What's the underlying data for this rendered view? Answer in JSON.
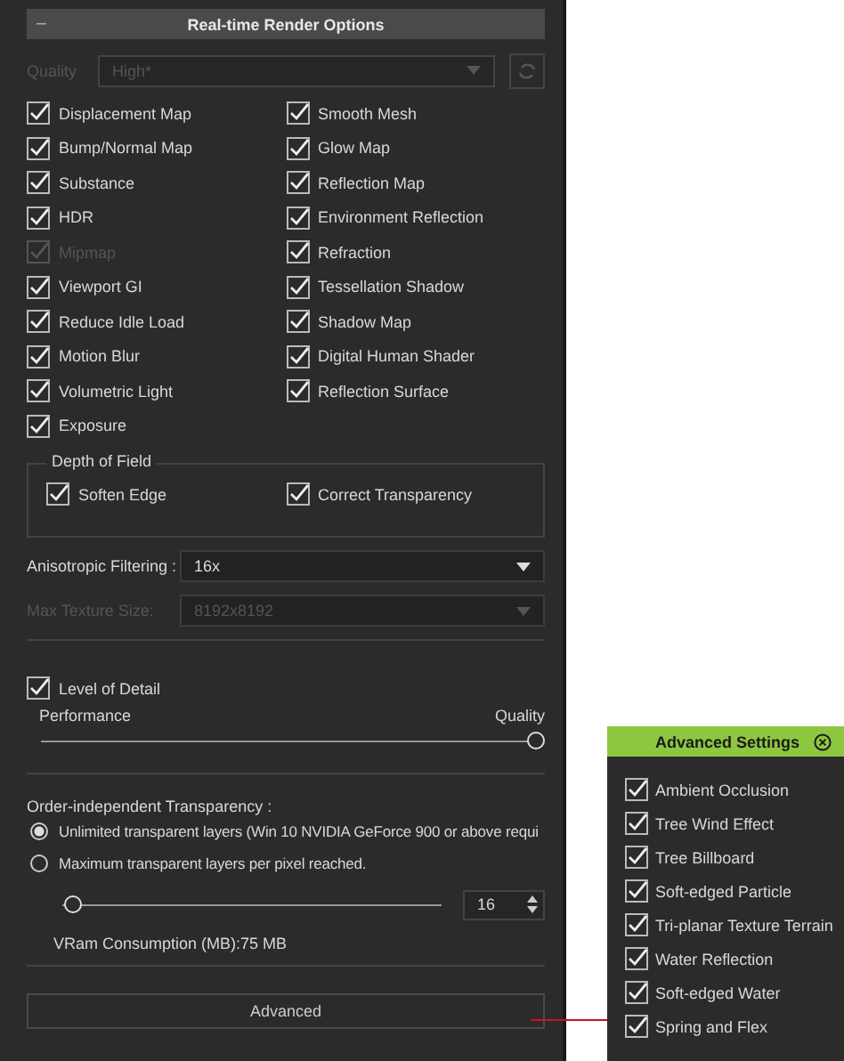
{
  "section_header": {
    "collapse_icon": "−",
    "title": "Real-time Render Options"
  },
  "quality": {
    "label": "Quality",
    "value": "High*",
    "disabled": true
  },
  "options_left": [
    {
      "label": "Displacement Map",
      "checked": true,
      "disabled": false
    },
    {
      "label": "Bump/Normal Map",
      "checked": true,
      "disabled": false
    },
    {
      "label": "Substance",
      "checked": true,
      "disabled": false
    },
    {
      "label": "HDR",
      "checked": true,
      "disabled": false
    },
    {
      "label": "Mipmap",
      "checked": true,
      "disabled": true
    },
    {
      "label": "Viewport GI",
      "checked": true,
      "disabled": false
    },
    {
      "label": "Reduce Idle Load",
      "checked": true,
      "disabled": false
    },
    {
      "label": "Motion Blur",
      "checked": true,
      "disabled": false
    },
    {
      "label": "Volumetric Light",
      "checked": true,
      "disabled": false
    },
    {
      "label": "Exposure",
      "checked": true,
      "disabled": false
    }
  ],
  "options_right": [
    {
      "label": "Smooth Mesh",
      "checked": true,
      "disabled": false
    },
    {
      "label": "Glow Map",
      "checked": true,
      "disabled": false
    },
    {
      "label": "Reflection Map",
      "checked": true,
      "disabled": false
    },
    {
      "label": "Environment Reflection",
      "checked": true,
      "disabled": false
    },
    {
      "label": "Refraction",
      "checked": true,
      "disabled": false
    },
    {
      "label": "Tessellation Shadow",
      "checked": true,
      "disabled": false
    },
    {
      "label": "Shadow Map",
      "checked": true,
      "disabled": false
    },
    {
      "label": "Digital Human Shader",
      "checked": true,
      "disabled": false
    },
    {
      "label": "Reflection Surface",
      "checked": true,
      "disabled": false
    }
  ],
  "depth_of_field": {
    "title": "Depth of Field",
    "options": [
      {
        "label": "Soften Edge",
        "checked": true
      },
      {
        "label": "Correct Transparency",
        "checked": true
      }
    ]
  },
  "anisotropic_filtering": {
    "label": "Anisotropic Filtering :",
    "value": "16x",
    "disabled": false
  },
  "max_texture_size": {
    "label": "Max Texture Size:",
    "value": "8192x8192",
    "disabled": true
  },
  "level_of_detail": {
    "label": "Level of Detail",
    "checked": true,
    "min_label": "Performance",
    "max_label": "Quality",
    "level": 1.0
  },
  "order_independent_transparency": {
    "title": "Order-independent Transparency :",
    "options": [
      {
        "label": "Unlimited transparent layers (Win 10  NVIDIA GeForce 900 or above requi",
        "selected": true
      },
      {
        "label": "Maximum transparent layers per pixel reached.",
        "selected": false
      }
    ],
    "layers_slider": {
      "level": 0.03,
      "value": "16"
    },
    "vram": "VRam Consumption (MB):75 MB"
  },
  "advanced_button": "Advanced",
  "advanced_settings": {
    "title": "Advanced Settings",
    "options": [
      {
        "label": "Ambient Occlusion",
        "checked": true
      },
      {
        "label": "Tree Wind Effect",
        "checked": true
      },
      {
        "label": "Tree Billboard",
        "checked": true
      },
      {
        "label": "Soft-edged Particle",
        "checked": true
      },
      {
        "label": "Tri-planar Texture Terrain",
        "checked": true
      },
      {
        "label": "Water Reflection",
        "checked": true
      },
      {
        "label": "Soft-edged Water",
        "checked": true
      },
      {
        "label": "Spring and Flex",
        "checked": true
      }
    ]
  }
}
